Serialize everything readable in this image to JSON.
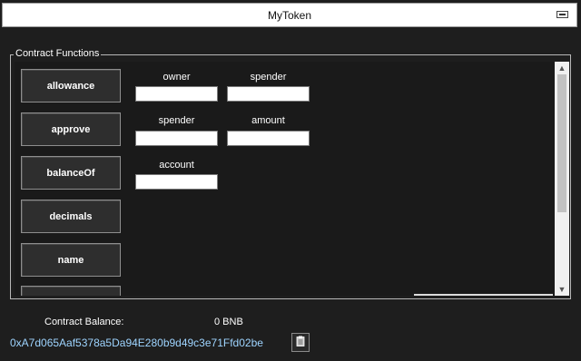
{
  "window": {
    "title": "MyToken"
  },
  "group": {
    "legend": "Contract Functions"
  },
  "functions": [
    {
      "label": "allowance",
      "params": [
        "owner",
        "spender"
      ]
    },
    {
      "label": "approve",
      "params": [
        "spender",
        "amount"
      ]
    },
    {
      "label": "balanceOf",
      "params": [
        "account"
      ]
    },
    {
      "label": "decimals",
      "params": []
    },
    {
      "label": "name",
      "params": []
    },
    {
      "label": "",
      "params": []
    }
  ],
  "inputs": {
    "allowance_owner": "",
    "allowance_spender": "",
    "approve_spender": "",
    "approve_amount": "",
    "balanceOf_account": ""
  },
  "footer": {
    "balance_label": "Contract Balance:",
    "balance_value": "0 BNB",
    "address": "0xA7d065Aaf5378a5Da94E280b9d49c3e71Ffd02be"
  },
  "icons": {
    "collapse": "minimize-icon",
    "copy": "clipboard-icon",
    "scroll_up": "chevron-up-icon",
    "scroll_down": "chevron-down-icon"
  }
}
